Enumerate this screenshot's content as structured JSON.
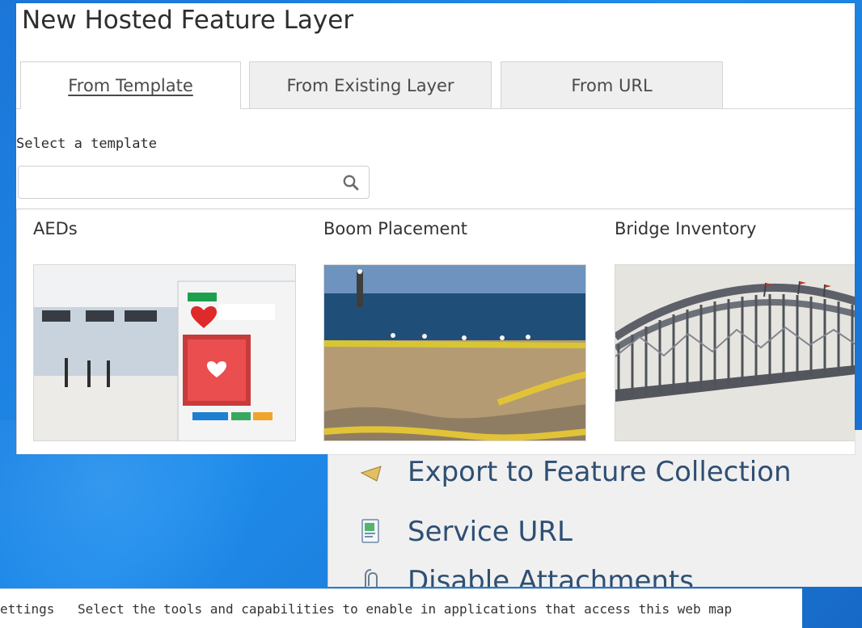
{
  "dialog": {
    "title": "New Hosted Feature Layer",
    "tabs": [
      {
        "label": "From Template",
        "active": true
      },
      {
        "label": "From Existing Layer",
        "active": false
      },
      {
        "label": "From URL",
        "active": false
      }
    ],
    "select_label": "Select a template",
    "search": {
      "value": "",
      "placeholder": "",
      "icon": "search-icon"
    },
    "templates": [
      {
        "title": "AEDs",
        "thumbnail": "aed-photo"
      },
      {
        "title": "Boom Placement",
        "thumbnail": "boom-photo"
      },
      {
        "title": "Bridge Inventory",
        "thumbnail": "bridge-photo"
      }
    ]
  },
  "context_menu": {
    "items": [
      {
        "label": "Export to Feature Collection",
        "icon": "export-icon"
      },
      {
        "label": "Service URL",
        "icon": "service-url-icon"
      },
      {
        "label": "Disable Attachments",
        "icon": "paperclip-icon"
      }
    ]
  },
  "settings_bar": {
    "title": "ettings",
    "description": "Select the tools and capabilities to enable in applications that access this web map"
  },
  "colors": {
    "desktop_blue": "#1f8ceb",
    "dialog_bg": "#ffffff",
    "menu_text": "#2f4f73"
  }
}
